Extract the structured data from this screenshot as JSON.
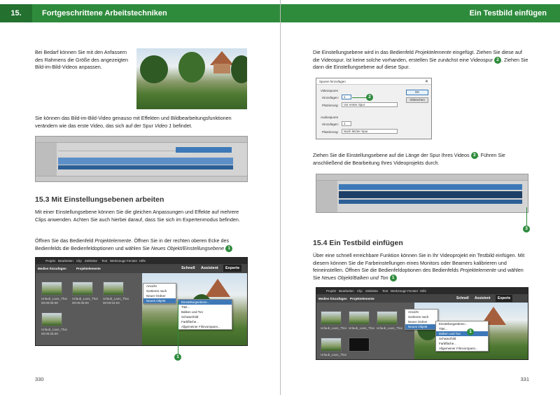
{
  "left": {
    "chapter_number": "15.",
    "chapter_title": "Fortgeschrittene Arbeitstechniken",
    "para1": "Bei Bedarf können Sie mit den Anfassern des Rahmens die Größe des angezeigten Bild-im-Bild-Videos anpassen.",
    "para2_a": "Sie können das Bild-im-Bild-Video genauso mit Effekten und Bildbearbeitungsfunktionen verändern wie das erste Video, das sich auf der Spur ",
    "para2_i": "Video 1",
    "para2_b": " befindet.",
    "section_title": "15.3  Mit Einstellungsebenen arbeiten",
    "para3": "Mit einer Einstellungsebene können Sie die gleichen Anpassungen und Effekte auf mehrere Clips anwenden. Achten Sie auch hierbei darauf, dass Sie sich im Expertenmodus befinden.",
    "para4_a": "Öffnen Sie das Bedienfeld ",
    "para4_i1": "Projektelemente",
    "para4_b": ". Öffnen Sie in der rechten oberen Ecke des Bedienfelds die Bedienfeldoptionen und wählen Sie ",
    "para4_i2": "Neues Objekt/Einstellungsebene",
    "para4_badge": "1",
    "page_number": "330",
    "screenshot": {
      "menu_items": [
        "Projekt",
        "Bearbeiten",
        "Clip",
        "Zeitleiste",
        "Text",
        "Werkzeuge",
        "Fenster",
        "Hilfe"
      ],
      "add_media": "Medien hinzufügen",
      "project_assets": "Projektelemente",
      "mode_quick": "Schnell",
      "mode_guided": "Assistent",
      "mode_expert": "Experte",
      "context_menu": [
        "Ansicht",
        "Sortieren nach",
        "Neuer Ordner",
        "Neues Objekt"
      ],
      "submenu": [
        "Einstellungsebene...",
        "Titel...",
        "Balken und Ton",
        "Schwarzbild",
        "Farbfläche...",
        "Allgemeiner Filmvorspann..."
      ],
      "thumb_labels": [
        "Urlaub_Laos_Thai",
        "Urlaub_Laos_Thai",
        "Urlaub_Laos_Thai",
        "Urlaub_Laos_Thai"
      ],
      "thumb_times": [
        "00:00:05:09",
        "00:00:05:00",
        "00:00:04:03",
        "00:00:25:09"
      ],
      "callout": "1"
    }
  },
  "right": {
    "chapter_title": "Ein Testbild einfügen",
    "para1_a": "Die Einstellungsebene wird in das Bedienfeld ",
    "para1_i": "Projektelemente",
    "para1_b": " eingefügt. Ziehen Sie diese auf die Videospur. Ist keine solche vorhanden, erstellen Sie zunächst eine Videospur ",
    "para1_badge": "2",
    "para1_c": ". Ziehen Sie dann die Einstellungsebene auf diese Spur.",
    "dialog": {
      "title": "Spuren hinzufügen",
      "video_group": "Videospuren",
      "add_label": "Hinzufügen:",
      "add_value": "1",
      "place_label": "Platzierung:",
      "place_value": "Vor erster Spur",
      "audio_group": "Audiospuren",
      "audio_add_label": "Hinzufügen:",
      "audio_add_value": "1",
      "audio_place_label": "Platzierung:",
      "audio_place_value": "Nach letzter Spur",
      "ok": "OK",
      "cancel": "Abbrechen",
      "callout": "2"
    },
    "para2_a": "Ziehen Sie die Einstellungsebene auf die Länge der Spur Ihres Videos ",
    "para2_badge": "3",
    "para2_b": ". Führen Sie anschließend die Bearbeitung Ihres Videoprojekts durch.",
    "timeline_callout": "3",
    "section_title": "15.4  Ein Testbild einfügen",
    "para3_a": "Über eine schnell erreichbare Funktion können Sie in Ihr Videoprojekt ein Testbild einfügen. Mit diesem können Sie die Farbeinstellungen eines Monitors oder Beamers kalibrieren und feineinstellen. Öffnen Sie die Bedienfeldoptionen des Bedienfelds ",
    "para3_i1": "Projektelemente",
    "para3_b": " und wählen Sie ",
    "para3_i2": "Neues Objekt/Balken und Ton",
    "para3_badge": "1",
    "page_number": "331",
    "screenshot": {
      "menu_items": [
        "Projekt",
        "Bearbeiten",
        "Clip",
        "Zeitleiste",
        "Text",
        "Werkzeuge",
        "Fenster",
        "Hilfe"
      ],
      "add_media": "Medien hinzufügen",
      "project_assets": "Projektelemente",
      "mode_quick": "Schnell",
      "mode_guided": "Assistent",
      "mode_expert": "Experte",
      "context_menu": [
        "Ansicht",
        "Sortieren nach",
        "Neuer Ordner",
        "Neues Objekt"
      ],
      "submenu": [
        "Einstellungsebene...",
        "Titel...",
        "Balken und Ton",
        "Schwarzbild",
        "Farbfläche...",
        "Allgemeiner Filmvorspann..."
      ],
      "thumb_labels": [
        "Urlaub_Laos_Thai",
        "Urlaub_Laos_Thai",
        "Urlaub_Laos_Thai",
        "Urlaub_Laos_Thai"
      ],
      "callout": "1"
    }
  },
  "colors": {
    "accent": "#2e8b3c",
    "accent_dark": "#23702f",
    "track_blue": "#3d79b8"
  }
}
